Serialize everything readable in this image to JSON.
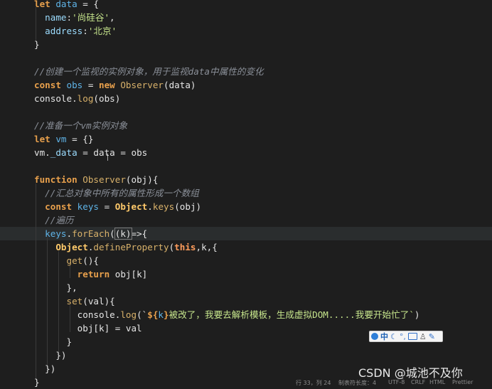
{
  "editor": {
    "lines": [
      {
        "tokens": [
          {
            "t": "let ",
            "c": "kw"
          },
          {
            "t": "data",
            "c": "var"
          },
          {
            "t": " = {",
            "c": "plain"
          }
        ]
      },
      {
        "tokens": [
          {
            "t": "  name",
            "c": "prop"
          },
          {
            "t": ":",
            "c": "plain"
          },
          {
            "t": "'尚硅谷'",
            "c": "str"
          },
          {
            "t": ",",
            "c": "plain"
          }
        ]
      },
      {
        "tokens": [
          {
            "t": "  address",
            "c": "prop"
          },
          {
            "t": ":",
            "c": "plain"
          },
          {
            "t": "'北京'",
            "c": "str"
          }
        ]
      },
      {
        "tokens": [
          {
            "t": "}",
            "c": "plain"
          }
        ]
      },
      {
        "tokens": []
      },
      {
        "tokens": [
          {
            "t": "//创建一个监视的实例对象，用于监视data中属性的变化",
            "c": "cmt"
          }
        ]
      },
      {
        "tokens": [
          {
            "t": "const ",
            "c": "kw"
          },
          {
            "t": "obs",
            "c": "var"
          },
          {
            "t": " = ",
            "c": "plain"
          },
          {
            "t": "new ",
            "c": "kw"
          },
          {
            "t": "Observer",
            "c": "fn"
          },
          {
            "t": "(data)",
            "c": "plain"
          }
        ]
      },
      {
        "tokens": [
          {
            "t": "console",
            "c": "plain"
          },
          {
            "t": ".",
            "c": "plain"
          },
          {
            "t": "log",
            "c": "fn"
          },
          {
            "t": "(obs)",
            "c": "plain"
          }
        ]
      },
      {
        "tokens": []
      },
      {
        "tokens": [
          {
            "t": "//准备一个vm实例对象",
            "c": "cmt"
          }
        ]
      },
      {
        "tokens": [
          {
            "t": "let ",
            "c": "kw"
          },
          {
            "t": "vm",
            "c": "var"
          },
          {
            "t": " = {}",
            "c": "plain"
          }
        ]
      },
      {
        "tokens": [
          {
            "t": "vm.",
            "c": "plain"
          },
          {
            "t": "_data",
            "c": "prop"
          },
          {
            "t": " = data = obs",
            "c": "plain"
          }
        ]
      },
      {
        "tokens": []
      },
      {
        "tokens": [
          {
            "t": "function ",
            "c": "kw"
          },
          {
            "t": "Observer",
            "c": "fn"
          },
          {
            "t": "(obj){",
            "c": "plain"
          }
        ]
      },
      {
        "tokens": [
          {
            "t": "  //汇总对象中所有的属性形成一个数组",
            "c": "cmt"
          }
        ]
      },
      {
        "tokens": [
          {
            "t": "  const ",
            "c": "kw"
          },
          {
            "t": "keys",
            "c": "var"
          },
          {
            "t": " = ",
            "c": "plain"
          },
          {
            "t": "Object",
            "c": "obj"
          },
          {
            "t": ".",
            "c": "plain"
          },
          {
            "t": "keys",
            "c": "fn"
          },
          {
            "t": "(obj)",
            "c": "plain"
          }
        ]
      },
      {
        "tokens": [
          {
            "t": "  //遍历",
            "c": "cmt"
          }
        ]
      },
      {
        "tokens": [
          {
            "t": "  keys",
            "c": "var"
          },
          {
            "t": ".",
            "c": "plain"
          },
          {
            "t": "forEach",
            "c": "fn"
          },
          {
            "t": "(",
            "c": "plain"
          },
          {
            "t": "(k)",
            "c": "plain"
          },
          {
            "t": "=>{",
            "c": "plain"
          }
        ],
        "highlight": true
      },
      {
        "tokens": [
          {
            "t": "    Object",
            "c": "obj"
          },
          {
            "t": ".",
            "c": "plain"
          },
          {
            "t": "defineProperty",
            "c": "fn"
          },
          {
            "t": "(",
            "c": "plain"
          },
          {
            "t": "this",
            "c": "kwb"
          },
          {
            "t": ",k,{",
            "c": "plain"
          }
        ]
      },
      {
        "tokens": [
          {
            "t": "      get",
            "c": "fn"
          },
          {
            "t": "(){",
            "c": "plain"
          }
        ]
      },
      {
        "tokens": [
          {
            "t": "        return ",
            "c": "kw"
          },
          {
            "t": "obj[k]",
            "c": "plain"
          }
        ]
      },
      {
        "tokens": [
          {
            "t": "      },",
            "c": "plain"
          }
        ]
      },
      {
        "tokens": [
          {
            "t": "      set",
            "c": "fn"
          },
          {
            "t": "(val){",
            "c": "plain"
          }
        ]
      },
      {
        "tokens": [
          {
            "t": "        console",
            "c": "plain"
          },
          {
            "t": ".",
            "c": "plain"
          },
          {
            "t": "log",
            "c": "fn"
          },
          {
            "t": "(`",
            "c": "plain"
          },
          {
            "t": "${",
            "c": "kw"
          },
          {
            "t": "k",
            "c": "var"
          },
          {
            "t": "}",
            "c": "kw"
          },
          {
            "t": "被改了，我要去解析模板，生成虚拟DOM.....我要开始忙了`",
            "c": "str"
          },
          {
            "t": ")",
            "c": "plain"
          }
        ]
      },
      {
        "tokens": [
          {
            "t": "        obj[k] = val",
            "c": "plain"
          }
        ]
      },
      {
        "tokens": [
          {
            "t": "      }",
            "c": "plain"
          }
        ]
      },
      {
        "tokens": [
          {
            "t": "    })",
            "c": "plain"
          }
        ]
      },
      {
        "tokens": [
          {
            "t": "  })",
            "c": "plain"
          }
        ]
      },
      {
        "tokens": [
          {
            "t": "}",
            "c": "plain"
          }
        ]
      }
    ]
  },
  "ime_toolbar": {
    "lang": "中",
    "icons": [
      "sogou-logo-icon",
      "moon-icon",
      "punctuation-icon",
      "keyboard-icon",
      "user-icon",
      "wrench-icon"
    ]
  },
  "watermark": "CSDN @城池不及你",
  "statusbar": {
    "items": [
      "行 33，列 24",
      "制表符长度：4",
      "UTF-8",
      "CRLF",
      "HTML",
      "Prettier"
    ]
  },
  "colors": {
    "background": "#1e1e1e",
    "keyword": "#e8a04c",
    "variable": "#5fb4e8",
    "string": "#c6e58c",
    "comment": "#8a8f98"
  }
}
